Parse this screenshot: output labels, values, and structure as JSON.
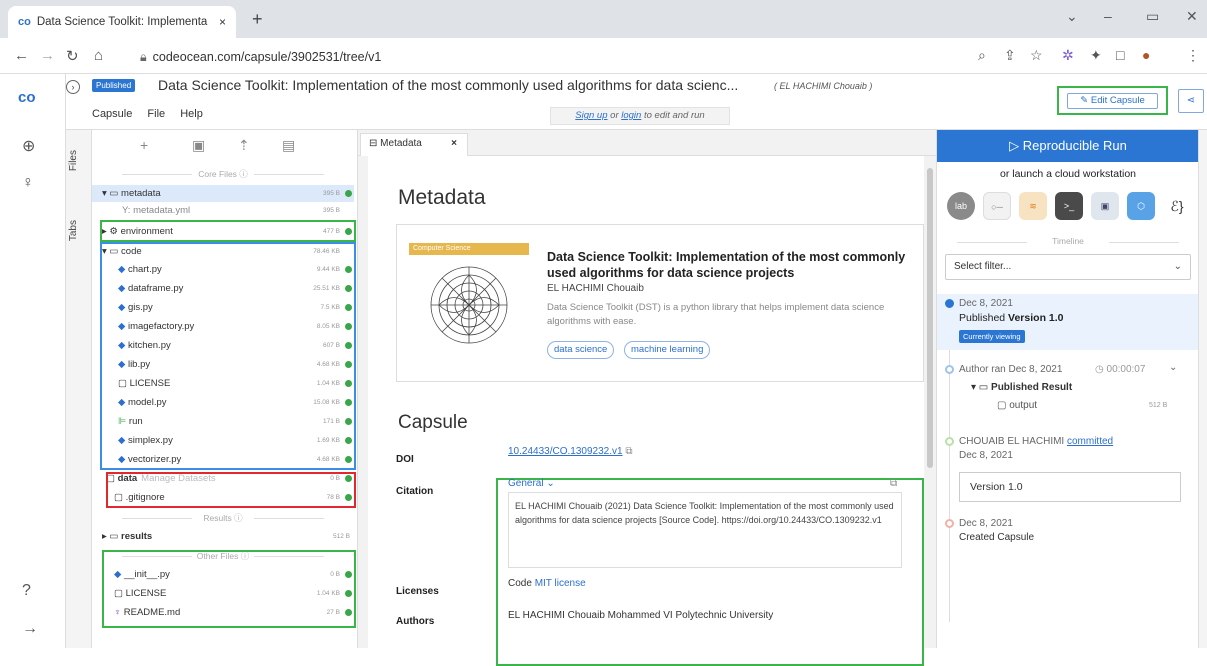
{
  "browser": {
    "tab_icon": "co",
    "tab_title": "Data Science Toolkit: Implementa",
    "tab_close": "×",
    "new_tab": "+",
    "min": "–",
    "restore": "▭",
    "close": "✕",
    "dropdown": "⌄",
    "url": "codeocean.com/capsule/3902531/tree/v1"
  },
  "capsule": {
    "published_badge": "Published",
    "title": "Data Science Toolkit: Implementation of the most commonly used algorithms for data scienc...",
    "author": "( EL HACHIMI Chouaib )",
    "menu": [
      "Capsule",
      "File",
      "Help"
    ],
    "signup_text": "Sign up",
    "signup_or": " or ",
    "login_text": "login",
    "signup_suffix": " to edit and run",
    "edit_button": "Edit Capsule"
  },
  "rail": {
    "logo": "co"
  },
  "vtabs": {
    "files": "Files",
    "tabs": "Tabs"
  },
  "files": {
    "core_header": "Core Files ⓘ",
    "results_header": "Results ⓘ",
    "other_header": "Other Files ⓘ",
    "data_hint": "Manage Datasets",
    "rows": [
      {
        "name": "metadata",
        "size": "395 B",
        "icon": "folder",
        "bold": true
      },
      {
        "name": "metadata.yml",
        "size": "395 B",
        "icon": "yaml"
      },
      {
        "name": "environment",
        "size": "477 B",
        "icon": "gear",
        "bold": true
      },
      {
        "name": "code",
        "size": "78.46 KB",
        "icon": "folder",
        "bold": true
      },
      {
        "name": "chart.py",
        "size": "9.44 KB",
        "icon": "py"
      },
      {
        "name": "dataframe.py",
        "size": "25.51 KB",
        "icon": "py"
      },
      {
        "name": "gis.py",
        "size": "7.5 KB",
        "icon": "py"
      },
      {
        "name": "imagefactory.py",
        "size": "8.05 KB",
        "icon": "py"
      },
      {
        "name": "kitchen.py",
        "size": "607 B",
        "icon": "py"
      },
      {
        "name": "lib.py",
        "size": "4.68 KB",
        "icon": "py"
      },
      {
        "name": "LICENSE",
        "size": "1.04 KB",
        "icon": "file"
      },
      {
        "name": "model.py",
        "size": "15.08 KB",
        "icon": "py"
      },
      {
        "name": "run",
        "size": "171 B",
        "icon": "run"
      },
      {
        "name": "simplex.py",
        "size": "1.69 KB",
        "icon": "py"
      },
      {
        "name": "vectorizer.py",
        "size": "4.68 KB",
        "icon": "py"
      },
      {
        "name": "data",
        "size": "0 B",
        "icon": "folder",
        "bold": true
      },
      {
        "name": ".gitignore",
        "size": "78 B",
        "icon": "file"
      },
      {
        "name": "results",
        "size": "512 B",
        "icon": "folder",
        "bold": true
      },
      {
        "name": "__init__.py",
        "size": "0 B",
        "icon": "py"
      },
      {
        "name": "LICENSE",
        "size": "1.04 KB",
        "icon": "file"
      },
      {
        "name": "README.md",
        "size": "27 B",
        "icon": "md"
      }
    ]
  },
  "metadata": {
    "tab_label": "Metadata",
    "tab_close": "×",
    "heading": "Metadata",
    "card": {
      "tag": "Computer Science",
      "title": "Data Science Toolkit: Implementation of the most commonly used algorithms for data science projects",
      "author": "EL HACHIMI Chouaib",
      "description": "Data Science Toolkit (DST) is a python library that helps implement data science algorithms with ease.",
      "tags": [
        "data science",
        "machine learning"
      ]
    },
    "capsule_heading": "Capsule",
    "doi_label": "DOI",
    "doi_value": "10.24433/CO.1309232.v1",
    "citation_label": "Citation",
    "citation_format": "General ⌄",
    "citation_text": "EL HACHIMI Chouaib (2021) Data Science Toolkit: Implementation of the most commonly used algorithms for data science projects [Source Code]. https://doi.org/10.24433/CO.1309232.v1",
    "licenses_label": "Licenses",
    "licenses_prefix": "Code ",
    "licenses_link": "MIT license",
    "authors_label": "Authors",
    "authors_value": "EL HACHIMI Chouaib Mohammed VI Polytechnic University"
  },
  "right": {
    "reproducible_run": "Reproducible Run",
    "launch": "or launch a cloud workstation",
    "workstations": [
      {
        "label": "lab",
        "color": "#8a8a8a"
      },
      {
        "label": "○─",
        "color": "#f2f2f2"
      },
      {
        "label": "≋",
        "color": "#f7e3c2"
      },
      {
        "label": ">_",
        "color": "#4a4a4a"
      },
      {
        "label": "▣",
        "color": "#dfe6ee"
      },
      {
        "label": "⬡",
        "color": "#5aa2e6"
      },
      {
        "label": "ℰ}",
        "color": "#ffffff"
      }
    ],
    "timeline": "Timeline",
    "filter_placeholder": "Select filter...",
    "events": {
      "e1_date": "Dec 8, 2021",
      "e1_title_prefix": "Published ",
      "e1_version": "Version 1.0",
      "e1_badge": "Currently viewing",
      "e2_text": "Author ran Dec 8, 2021",
      "e2_time": "◷ 00:00:07",
      "e2_chev": "⌄",
      "e2_folder": "Published Result",
      "e2_output": "output",
      "e2_output_size": "512 B",
      "e3_author": "CHOUAIB EL HACHIMI ",
      "e3_link": "committed",
      "e3_date": "Dec 8, 2021",
      "e3_version": "Version 1.0",
      "e4_date": "Dec 8, 2021",
      "e4_text": "Created Capsule"
    }
  }
}
